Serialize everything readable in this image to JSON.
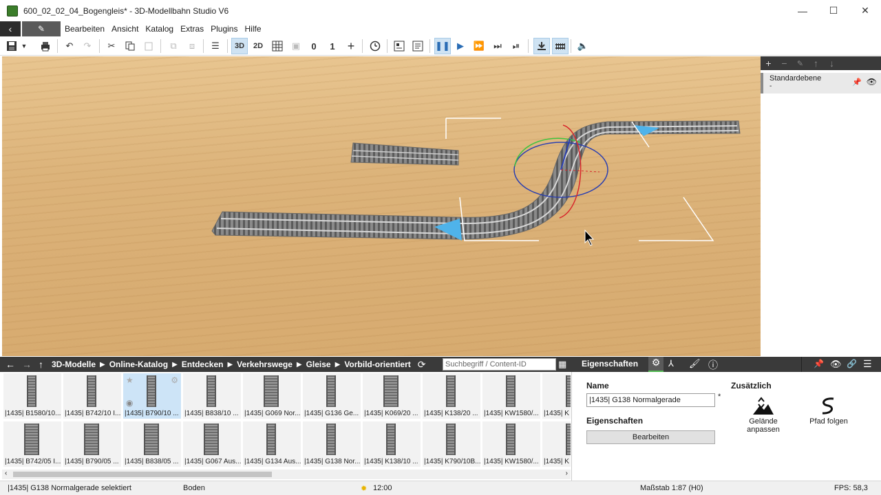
{
  "window": {
    "title": "600_02_02_04_Bogengleis* - 3D-Modellbahn Studio V6",
    "minimize": "—",
    "maximize": "☐",
    "close": "✕"
  },
  "menu": {
    "back_icon": "‹",
    "edit_icon": "✎",
    "items": [
      "Bearbeiten",
      "Ansicht",
      "Katalog",
      "Extras",
      "Plugins",
      "Hilfe"
    ]
  },
  "toolbar": {
    "view_3d": "3D",
    "view_2d": "2D",
    "count_0": "0",
    "count_1": "1"
  },
  "layers": {
    "name": "Standardebene",
    "sub": "-"
  },
  "browse": {
    "crumbs": [
      "3D-Modelle",
      "Online-Katalog",
      "Entdecken",
      "Verkehrswege",
      "Gleise",
      "Vorbild-orientiert"
    ],
    "search_placeholder": "Suchbegriff / Content-ID"
  },
  "catalog": {
    "row1": [
      "|1435| B1580/10...",
      "|1435| B742/10 I...",
      "|1435| B790/10 ...",
      "|1435| B838/10 ...",
      "|1435| G069 Nor...",
      "|1435| G136 Ge...",
      "|1435| K069/20 ...",
      "|1435| K138/20 ...",
      "|1435| KW1580/...",
      "|1435| K"
    ],
    "row2": [
      "|1435| B742/05 I...",
      "|1435| B790/05 ...",
      "|1435| B838/05 ...",
      "|1435| G067 Aus...",
      "|1435| G134 Aus...",
      "|1435| G138 Nor...",
      "|1435| K138/10 ...",
      "|1435| K790/10B...",
      "|1435| KW1580/...",
      "|1435| K"
    ]
  },
  "properties": {
    "tab": "Eigenschaften",
    "name_heading": "Name",
    "name_value": "|1435| G138 Normalgerade",
    "name_required": "*",
    "props_heading": "Eigenschaften",
    "edit_button": "Bearbeiten",
    "extra_heading": "Zusätzlich",
    "terrain_label": "Gelände anpassen",
    "path_label": "Pfad folgen"
  },
  "status": {
    "selection": "|1435| G138 Normalgerade selektiert",
    "ground": "Boden",
    "time": "12:00",
    "scale": "Maßstab 1:87 (H0)",
    "fps": "FPS: 58,3"
  }
}
